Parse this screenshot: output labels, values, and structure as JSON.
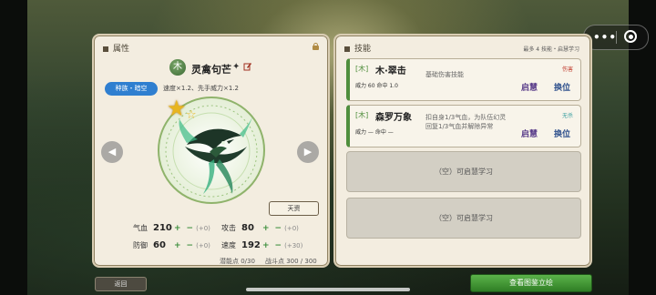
{
  "attributes_panel": {
    "title": "属性",
    "element_badge": "木",
    "beast_name": "灵禽句芒",
    "diamond_icon": "✦",
    "race_tag": "种族・暗空",
    "traits": "速度×1.2、先手威力×1.2",
    "talent_button": "天资",
    "stats": [
      {
        "label": "气血",
        "value": "210",
        "plus": "+",
        "minus": "−",
        "bonus": "(+0)"
      },
      {
        "label": "攻击",
        "value": "80",
        "plus": "+",
        "minus": "−",
        "bonus": "(+0)"
      },
      {
        "label": "防御",
        "value": "60",
        "plus": "+",
        "minus": "−",
        "bonus": "(+0)"
      },
      {
        "label": "速度",
        "value": "192",
        "plus": "+",
        "minus": "−",
        "bonus": "(+30)"
      }
    ],
    "potential_points": "潜能点 0/30",
    "combat_points": "战斗点 300 / 300"
  },
  "skills_panel": {
    "title": "技能",
    "hint": "最多 4 技能・启慧学习",
    "skills": [
      {
        "element": "[木]",
        "name": "木·翠击",
        "description": "基础伤害技能",
        "tag": "伤害",
        "tag_color": "#c0392b",
        "stats": "威力 60   命中 1.0",
        "enlighten_label": "启慧",
        "swap_label": "换位"
      },
      {
        "element": "[木]",
        "name": "森罗万象",
        "description_line1": "扣自身1/3气血，为队伍幻灵",
        "description_line2": "回复1/3气血并解除异常",
        "tag": "无杀",
        "tag_color": "#3a9fa0",
        "stats": "威力 —   命中 —",
        "enlighten_label": "启慧",
        "swap_label": "换位"
      }
    ],
    "empty_slots": [
      "（空）可启慧学习",
      "（空）可启慧学习"
    ]
  },
  "bottom": {
    "back_label": "返回",
    "confirm_label": "查看图鉴立绘"
  },
  "capsule": {
    "more": "•••"
  },
  "colors": {
    "accent_green": "#4f8e3c",
    "enlighten_purple": "#5a3d8a",
    "swap_blue": "#2d4f8c",
    "race_blue": "#2f7fd0"
  }
}
